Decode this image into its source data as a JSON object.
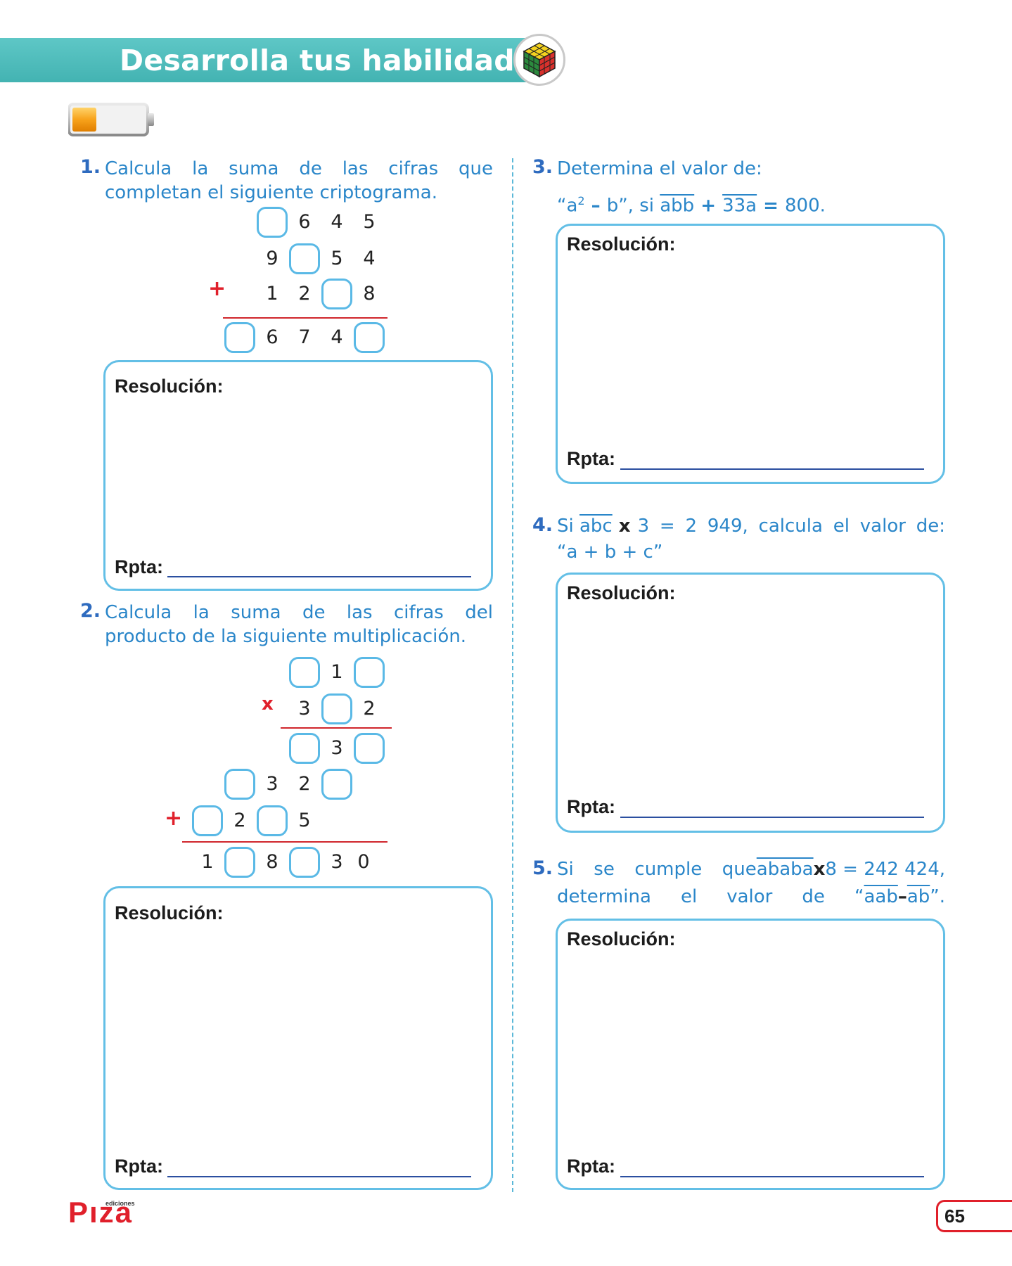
{
  "header": {
    "title": "Desarrolla tus habilidades"
  },
  "labels": {
    "resolution": "Resolución:",
    "answer": "Rpta:"
  },
  "p1": {
    "number": "1.",
    "text": "Calcula la suma de las cifras que completan el siguiente criptograma.",
    "line1": "Calcula la suma de las cifras que",
    "line2": "completan el siguiente criptograma.",
    "rows": [
      [
        "6",
        "4",
        "5"
      ],
      [
        "9",
        "5",
        "4"
      ],
      [
        "1",
        "2",
        "8"
      ],
      [
        "6",
        "7",
        "4"
      ]
    ],
    "operator": "+"
  },
  "p2": {
    "number": "2.",
    "line1": "Calcula la suma de las cifras del",
    "line2": "producto de la siguiente multiplicación.",
    "rows": [
      [
        "1"
      ],
      [
        "3",
        "2"
      ],
      [
        "3"
      ],
      [
        "3",
        "2"
      ],
      [
        "2",
        "5"
      ],
      [
        "1",
        "8",
        "3",
        "0"
      ]
    ],
    "operator_mult": "x",
    "operator_add": "+"
  },
  "p3": {
    "number": "3.",
    "line1": "Determina el valor de:",
    "open_quote": "“a",
    "sup": "2",
    "minus": " – ",
    "b_close": "b”, si ",
    "abb": "abb",
    "plus": " + ",
    "n33a": "33a",
    "equals": " = ",
    "result": "800."
  },
  "p4": {
    "number": "4.",
    "si": "Si ",
    "abc": "abc",
    "times": " x ",
    "rest": "3 = 2 949, calcula el valor de:",
    "line2": "“a + b + c”"
  },
  "p5": {
    "number": "5.",
    "si": "Si se cumple que ",
    "ababa": "ababa",
    "times": " x ",
    "rest": "8 = 242 424,",
    "line2a": "determina el valor de “",
    "aab": "aab",
    "minus": " – ",
    "ab": "ab",
    "close": "”."
  },
  "footer": {
    "logo": "Pıza",
    "logo_small": "ediciones",
    "page_number": "65"
  },
  "colors": {
    "banner": "#4dbcbb",
    "accent_blue": "#2a86c9",
    "box_border": "#63bfe6",
    "red": "#e0202b"
  }
}
